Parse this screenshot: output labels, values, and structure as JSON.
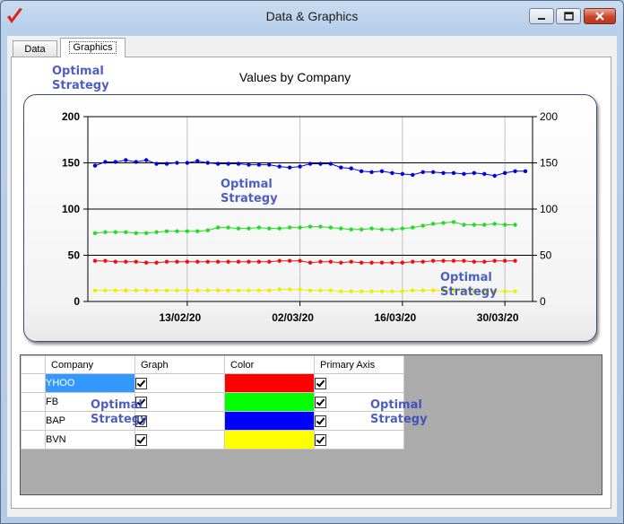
{
  "window": {
    "title": "Data & Graphics"
  },
  "tabs": [
    {
      "label": "Data",
      "active": false
    },
    {
      "label": "Graphics",
      "active": true
    }
  ],
  "watermark": {
    "line1": "Optimal",
    "line2": "Strategy"
  },
  "colors": {
    "accent_blue": "#2f45b8",
    "selection": "#3399ff"
  },
  "chart_data": {
    "type": "line",
    "title": "Values by Company",
    "xlabel": "",
    "ylabel": "",
    "ylim": [
      0,
      200
    ],
    "y_ticks": [
      "0",
      "50",
      "100",
      "150",
      "200"
    ],
    "y2_ticks": [
      "0",
      "50",
      "100",
      "150",
      "200"
    ],
    "x_tick_labels": [
      "13/02/20",
      "02/03/20",
      "16/03/20",
      "30/03/20"
    ],
    "x_tick_index": [
      9,
      20,
      30,
      40
    ],
    "grid": true,
    "legend": "none",
    "series": [
      {
        "color": "#0000dd",
        "values": [
          147,
          151,
          151,
          153,
          151,
          153,
          149,
          149,
          150,
          150,
          152,
          150,
          149,
          149,
          149,
          148,
          148,
          148,
          146,
          145,
          146,
          149,
          149,
          149,
          145,
          144,
          141,
          140,
          141,
          139,
          138,
          137,
          140,
          140,
          139,
          139,
          138,
          139,
          138,
          136,
          139,
          141,
          141
        ]
      },
      {
        "color": "#22dd22",
        "values": [
          74,
          75,
          75,
          75,
          74,
          74,
          75,
          76,
          76,
          76,
          76,
          77,
          80,
          80,
          79,
          79,
          80,
          79,
          79,
          80,
          80,
          81,
          81,
          80,
          79,
          78,
          78,
          79,
          78,
          78,
          79,
          80,
          82,
          84,
          85,
          86,
          83,
          83,
          83,
          84,
          83,
          83
        ]
      },
      {
        "color": "#ee1111",
        "values": [
          44,
          44,
          43,
          43,
          43,
          42,
          42,
          43,
          43,
          43,
          43,
          43,
          43,
          43,
          43,
          43,
          43,
          43,
          44,
          44,
          44,
          42,
          43,
          43,
          42,
          43,
          42,
          42,
          42,
          42,
          42,
          43,
          43,
          44,
          44,
          44,
          44,
          43,
          43,
          44,
          44,
          44
        ]
      },
      {
        "color": "#eeee00",
        "values": [
          12,
          12,
          12,
          12,
          12,
          12,
          12,
          12,
          12,
          12,
          12,
          12,
          12,
          12,
          12,
          12,
          12,
          12,
          13,
          13,
          13,
          12,
          12,
          12,
          11,
          11,
          11,
          11,
          11,
          11,
          11,
          12,
          12,
          12,
          12,
          12,
          12,
          11,
          11,
          11,
          11,
          11
        ]
      }
    ]
  },
  "grid": {
    "columns": [
      "Company",
      "Graph",
      "Color",
      "Primary Axis"
    ],
    "rows": [
      {
        "company": "YHOO",
        "graph": true,
        "color": "#ff0000",
        "primary": true
      },
      {
        "company": "FB",
        "graph": true,
        "color": "#00ff00",
        "primary": true
      },
      {
        "company": "BAP",
        "graph": true,
        "color": "#0000ff",
        "primary": true
      },
      {
        "company": "BVN",
        "graph": true,
        "color": "#ffff00",
        "primary": true
      }
    ]
  }
}
